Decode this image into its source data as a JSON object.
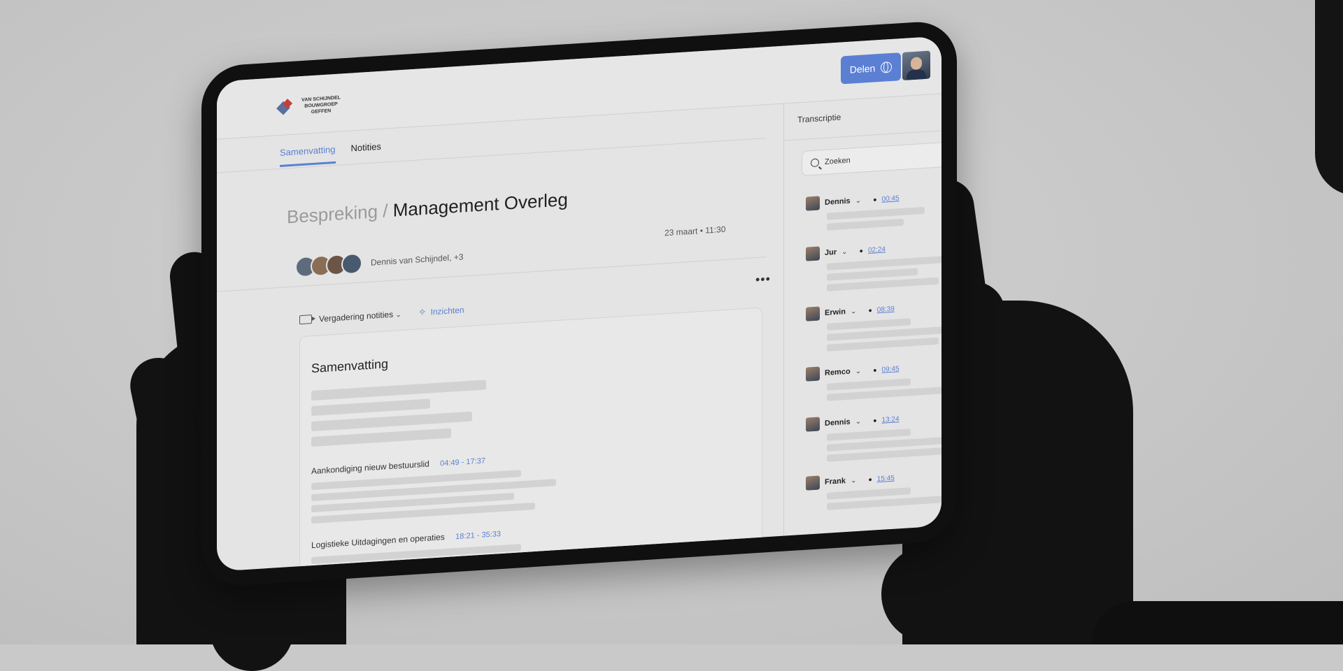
{
  "logo": {
    "text": "VAN SCHIJNDEL BOUWGROEP GEFFEN"
  },
  "header": {
    "share_label": "Delen"
  },
  "tabs": [
    {
      "label": "Samenvatting",
      "active": true
    },
    {
      "label": "Notities",
      "active": false
    }
  ],
  "meeting": {
    "breadcrumb": "Bespreking /",
    "title": "Management Overleg",
    "participants": "Dennis van Schijndel, +3",
    "date": "23 maart • 11:30"
  },
  "notes": {
    "selector_label": "Vergadering notities",
    "insights_label": "Inzichten",
    "more": "•••"
  },
  "summary": {
    "title": "Samenvatting",
    "topics": [
      {
        "title": "Aankondiging nieuw bestuurslid",
        "time": "04:49 - 17:37"
      },
      {
        "title": "Logistieke Uitdagingen en operaties",
        "time": "18:21 - 35:33"
      }
    ]
  },
  "transcript": {
    "title": "Transcriptie",
    "search_placeholder": "Zoeken",
    "entries": [
      {
        "name": "Dennis",
        "time": "00:45"
      },
      {
        "name": "Jur",
        "time": "02:24"
      },
      {
        "name": "Erwin",
        "time": "08:39"
      },
      {
        "name": "Remco",
        "time": "09:45"
      },
      {
        "name": "Dennis",
        "time": "13:24"
      },
      {
        "name": "Frank",
        "time": "15:45"
      }
    ]
  },
  "colors": {
    "accent": "#5b7fd3",
    "background": "#c9c9c9",
    "screen": "#e4e4e4"
  }
}
